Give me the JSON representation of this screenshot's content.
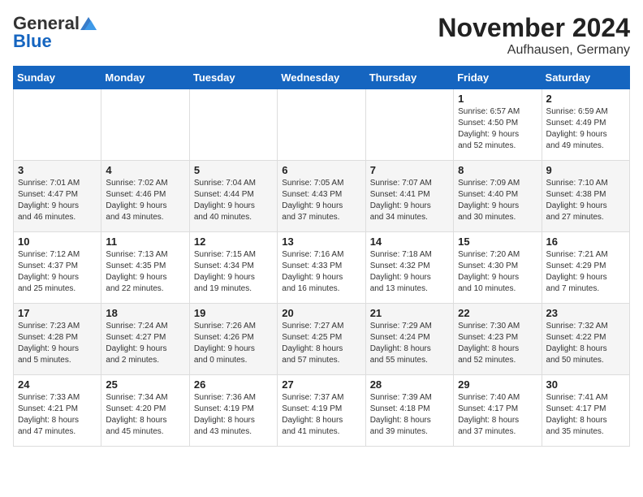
{
  "header": {
    "logo_general": "General",
    "logo_blue": "Blue",
    "month_title": "November 2024",
    "location": "Aufhausen, Germany"
  },
  "days_of_week": [
    "Sunday",
    "Monday",
    "Tuesday",
    "Wednesday",
    "Thursday",
    "Friday",
    "Saturday"
  ],
  "weeks": [
    [
      {
        "day": "",
        "info": ""
      },
      {
        "day": "",
        "info": ""
      },
      {
        "day": "",
        "info": ""
      },
      {
        "day": "",
        "info": ""
      },
      {
        "day": "",
        "info": ""
      },
      {
        "day": "1",
        "info": "Sunrise: 6:57 AM\nSunset: 4:50 PM\nDaylight: 9 hours\nand 52 minutes."
      },
      {
        "day": "2",
        "info": "Sunrise: 6:59 AM\nSunset: 4:49 PM\nDaylight: 9 hours\nand 49 minutes."
      }
    ],
    [
      {
        "day": "3",
        "info": "Sunrise: 7:01 AM\nSunset: 4:47 PM\nDaylight: 9 hours\nand 46 minutes."
      },
      {
        "day": "4",
        "info": "Sunrise: 7:02 AM\nSunset: 4:46 PM\nDaylight: 9 hours\nand 43 minutes."
      },
      {
        "day": "5",
        "info": "Sunrise: 7:04 AM\nSunset: 4:44 PM\nDaylight: 9 hours\nand 40 minutes."
      },
      {
        "day": "6",
        "info": "Sunrise: 7:05 AM\nSunset: 4:43 PM\nDaylight: 9 hours\nand 37 minutes."
      },
      {
        "day": "7",
        "info": "Sunrise: 7:07 AM\nSunset: 4:41 PM\nDaylight: 9 hours\nand 34 minutes."
      },
      {
        "day": "8",
        "info": "Sunrise: 7:09 AM\nSunset: 4:40 PM\nDaylight: 9 hours\nand 30 minutes."
      },
      {
        "day": "9",
        "info": "Sunrise: 7:10 AM\nSunset: 4:38 PM\nDaylight: 9 hours\nand 27 minutes."
      }
    ],
    [
      {
        "day": "10",
        "info": "Sunrise: 7:12 AM\nSunset: 4:37 PM\nDaylight: 9 hours\nand 25 minutes."
      },
      {
        "day": "11",
        "info": "Sunrise: 7:13 AM\nSunset: 4:35 PM\nDaylight: 9 hours\nand 22 minutes."
      },
      {
        "day": "12",
        "info": "Sunrise: 7:15 AM\nSunset: 4:34 PM\nDaylight: 9 hours\nand 19 minutes."
      },
      {
        "day": "13",
        "info": "Sunrise: 7:16 AM\nSunset: 4:33 PM\nDaylight: 9 hours\nand 16 minutes."
      },
      {
        "day": "14",
        "info": "Sunrise: 7:18 AM\nSunset: 4:32 PM\nDaylight: 9 hours\nand 13 minutes."
      },
      {
        "day": "15",
        "info": "Sunrise: 7:20 AM\nSunset: 4:30 PM\nDaylight: 9 hours\nand 10 minutes."
      },
      {
        "day": "16",
        "info": "Sunrise: 7:21 AM\nSunset: 4:29 PM\nDaylight: 9 hours\nand 7 minutes."
      }
    ],
    [
      {
        "day": "17",
        "info": "Sunrise: 7:23 AM\nSunset: 4:28 PM\nDaylight: 9 hours\nand 5 minutes."
      },
      {
        "day": "18",
        "info": "Sunrise: 7:24 AM\nSunset: 4:27 PM\nDaylight: 9 hours\nand 2 minutes."
      },
      {
        "day": "19",
        "info": "Sunrise: 7:26 AM\nSunset: 4:26 PM\nDaylight: 9 hours\nand 0 minutes."
      },
      {
        "day": "20",
        "info": "Sunrise: 7:27 AM\nSunset: 4:25 PM\nDaylight: 8 hours\nand 57 minutes."
      },
      {
        "day": "21",
        "info": "Sunrise: 7:29 AM\nSunset: 4:24 PM\nDaylight: 8 hours\nand 55 minutes."
      },
      {
        "day": "22",
        "info": "Sunrise: 7:30 AM\nSunset: 4:23 PM\nDaylight: 8 hours\nand 52 minutes."
      },
      {
        "day": "23",
        "info": "Sunrise: 7:32 AM\nSunset: 4:22 PM\nDaylight: 8 hours\nand 50 minutes."
      }
    ],
    [
      {
        "day": "24",
        "info": "Sunrise: 7:33 AM\nSunset: 4:21 PM\nDaylight: 8 hours\nand 47 minutes."
      },
      {
        "day": "25",
        "info": "Sunrise: 7:34 AM\nSunset: 4:20 PM\nDaylight: 8 hours\nand 45 minutes."
      },
      {
        "day": "26",
        "info": "Sunrise: 7:36 AM\nSunset: 4:19 PM\nDaylight: 8 hours\nand 43 minutes."
      },
      {
        "day": "27",
        "info": "Sunrise: 7:37 AM\nSunset: 4:19 PM\nDaylight: 8 hours\nand 41 minutes."
      },
      {
        "day": "28",
        "info": "Sunrise: 7:39 AM\nSunset: 4:18 PM\nDaylight: 8 hours\nand 39 minutes."
      },
      {
        "day": "29",
        "info": "Sunrise: 7:40 AM\nSunset: 4:17 PM\nDaylight: 8 hours\nand 37 minutes."
      },
      {
        "day": "30",
        "info": "Sunrise: 7:41 AM\nSunset: 4:17 PM\nDaylight: 8 hours\nand 35 minutes."
      }
    ]
  ]
}
